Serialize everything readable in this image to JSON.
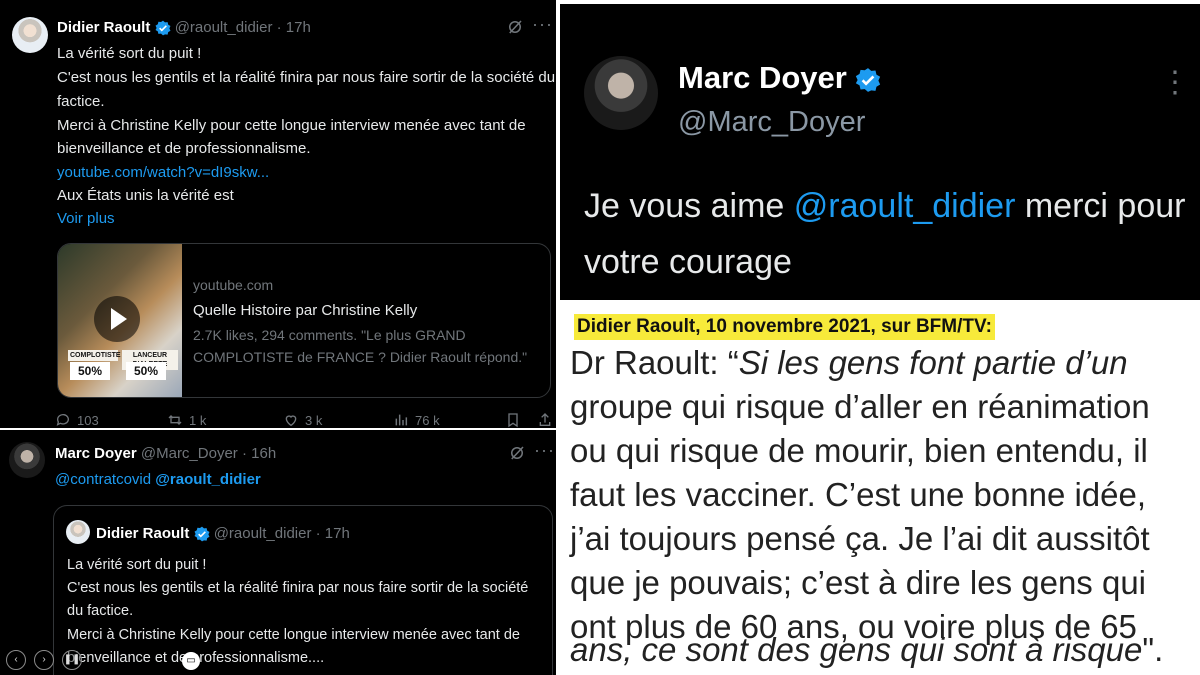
{
  "tweet1": {
    "author": "Didier Raoult",
    "handle": "@raoult_didier",
    "time": "· 17h",
    "lines": [
      "La vérité sort du puit !",
      "C'est nous les gentils et la réalité finira par nous faire sortir de la société du",
      "factice.",
      "Merci à Christine Kelly pour cette longue interview menée avec tant de",
      "bienveillance et de professionnalisme."
    ],
    "link": "youtube.com/watch?v=dI9skw...",
    "line_after_link": "Aux États unis la vérité est",
    "show_more": "Voir plus",
    "card": {
      "domain": "youtube.com",
      "title": "Quelle Histoire par Christine Kelly",
      "desc_line1": "2.7K likes, 294 comments. \"Le plus GRAND",
      "desc_line2": "COMPLOTISTE de FRANCE ? Didier Raoult répond.\"",
      "thumb_label_left": "COMPLOTISTE",
      "thumb_label_right": "LANCEUR D'ALERTE",
      "thumb_pct_left": "50%",
      "thumb_pct_right": "50%"
    },
    "stats": {
      "replies": "103",
      "retweets": "1 k",
      "likes": "3 k",
      "views": "76 k"
    }
  },
  "tweet2": {
    "author": "Marc Doyer",
    "handle": "@Marc_Doyer",
    "time": "· 16h",
    "reply_to_1": "@contratcovid",
    "reply_to_2": "@raoult_didier",
    "quoted": {
      "author": "Didier Raoult",
      "handle": "@raoult_didier",
      "time": "· 17h",
      "lines": [
        "La vérité sort du puit !",
        "C'est nous les gentils et la réalité finira par nous faire sortir de la société",
        "du factice.",
        "Merci à Christine Kelly pour cette longue interview menée avec tant de",
        "bienveillance et de professionnalisme...."
      ]
    }
  },
  "doyer_tweet": {
    "author": "Marc Doyer",
    "handle": "@Marc_Doyer",
    "line1_pre": "Je vous aime ",
    "line1_mention": "@raoult_didier",
    "line1_post": " merci pour",
    "line2": "votre courage"
  },
  "quote_panel": {
    "heading": "Didier Raoult, 10 novembre 2021, sur BFM/TV:",
    "speaker": "Dr Raoult: “",
    "line1_rest": "Si les gens font partie d’un",
    "lines": [
      "groupe qui risque d’aller en réanimation",
      "ou qui risque de mourir, bien entendu, il",
      "faut les vacciner. C’est une bonne idée,",
      "j’ai toujours pensé ça. Je l’ai dit aussitôt",
      "que je pouvais; c’est à dire les gens qui",
      "ont plus de 60 ans, ou voire plus de 65"
    ],
    "last_line": "ans, ce sont des gens qui sont à risque",
    "closing": "\"."
  },
  "colors": {
    "background": "#000000",
    "link": "#1d9bf0",
    "verified": "#1d9bf0",
    "highlight": "#f7ea3a",
    "muted": "#71767b"
  }
}
